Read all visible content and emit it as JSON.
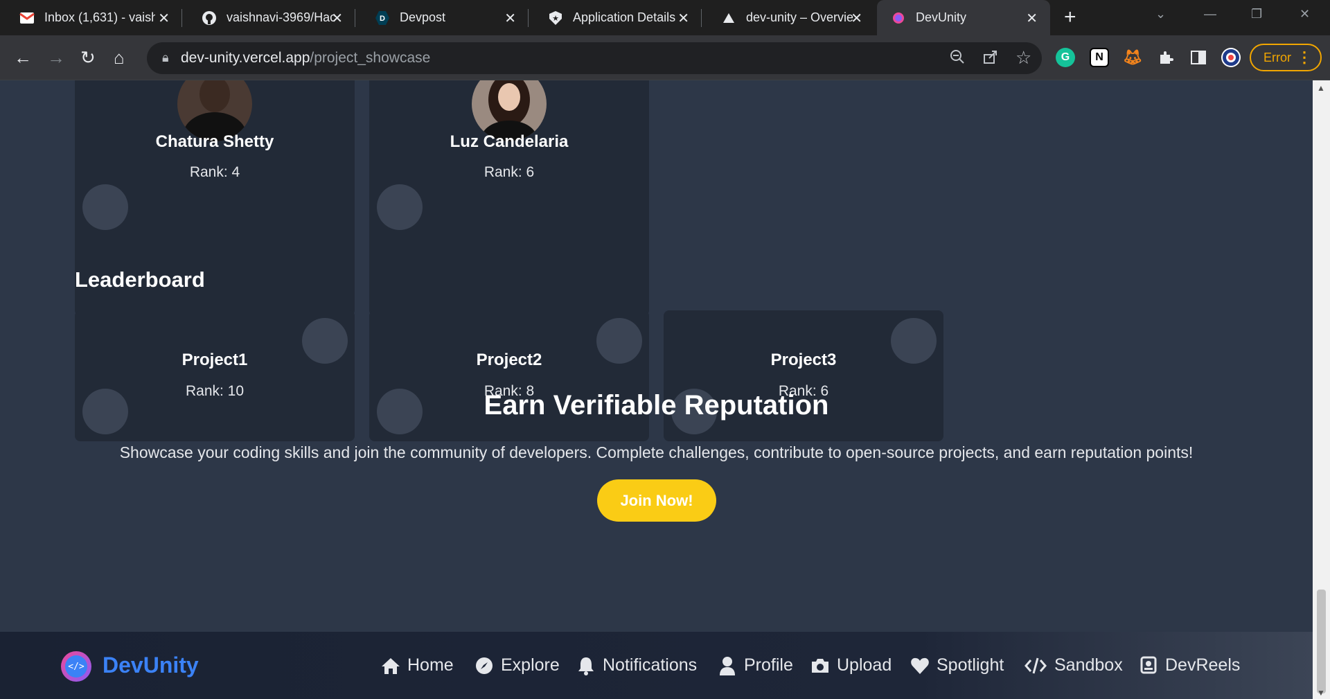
{
  "browser": {
    "tabs": [
      {
        "title": "Inbox (1,631) - vaish",
        "icon": "gmail-icon"
      },
      {
        "title": "vaishnavi-3969/Hac",
        "icon": "github-icon"
      },
      {
        "title": "Devpost",
        "icon": "devpost-icon"
      },
      {
        "title": "Application Details",
        "icon": "shield-star-icon"
      },
      {
        "title": "dev-unity – Overvie",
        "icon": "vercel-triangle-icon"
      },
      {
        "title": "DevUnity",
        "icon": "devunity-icon"
      }
    ],
    "url_host": "dev-unity.vercel.app",
    "url_path": "/project_showcase",
    "error_label": "Error"
  },
  "developers": [
    {
      "name": "Chatura Shetty",
      "rank": "Rank: 4"
    },
    {
      "name": "Luz Candelaria",
      "rank": "Rank: 6"
    }
  ],
  "leaderboard": {
    "title": "Leaderboard",
    "items": [
      {
        "name": "Project1",
        "rank": "Rank: 10"
      },
      {
        "name": "Project2",
        "rank": "Rank: 8"
      },
      {
        "name": "Project3",
        "rank": "Rank: 6"
      }
    ]
  },
  "hero": {
    "title": "Earn Verifiable Reputation",
    "text": "Showcase your coding skills and join the community of developers. Complete challenges, contribute to open-source projects, and earn reputation points!",
    "cta": "Join Now!"
  },
  "footer": {
    "brand": "DevUnity",
    "links": [
      {
        "label": "Home",
        "icon": "home-icon"
      },
      {
        "label": "Explore",
        "icon": "compass-icon"
      },
      {
        "label": "Notifications",
        "icon": "bell-icon"
      },
      {
        "label": "Profile",
        "icon": "user-icon"
      },
      {
        "label": "Upload",
        "icon": "camera-icon"
      },
      {
        "label": "Spotlight",
        "icon": "heart-icon"
      },
      {
        "label": "Sandbox",
        "icon": "code-icon"
      },
      {
        "label": "DevReels",
        "icon": "reel-icon"
      }
    ]
  },
  "colors": {
    "page_bg": "#2d3748",
    "card_bg": "#222a37",
    "cta": "#facc15",
    "brand": "#3b82f6"
  }
}
